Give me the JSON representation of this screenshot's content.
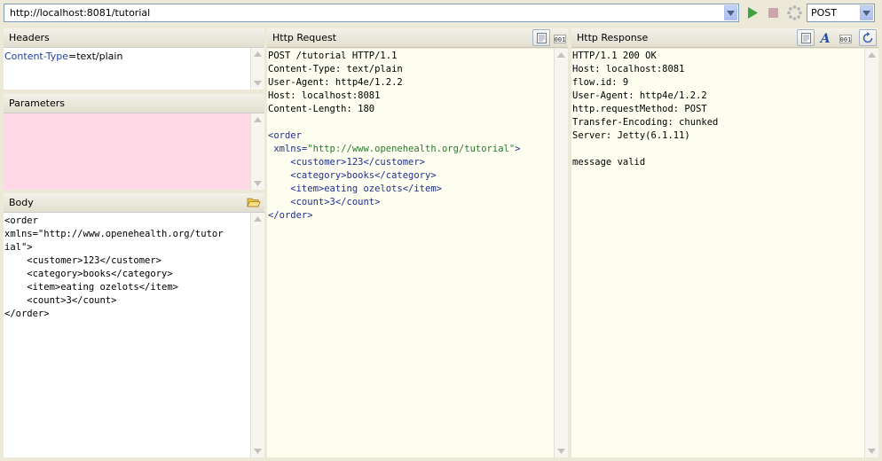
{
  "toolbar": {
    "url": "http://localhost:8081/tutorial",
    "method": "POST",
    "icons": [
      "dropdown-arrow-icon",
      "run-icon",
      "stop-icon",
      "busy-icon",
      "dropdown-arrow-icon"
    ]
  },
  "headers": {
    "title": "Headers",
    "entry_key": "Content-Type",
    "entry_sep": "=",
    "entry_value": "text/plain"
  },
  "parameters": {
    "title": "Parameters"
  },
  "body": {
    "title": "Body",
    "lines": [
      "<order",
      "xmlns=\"http://www.openehealth.org/tutor",
      "ial\">",
      "    <customer>123</customer>",
      "    <category>books</category>",
      "    <item>eating ozelots</item>",
      "    <count>3</count>",
      "</order>"
    ]
  },
  "request": {
    "title": "Http Request",
    "header_lines": [
      "POST /tutorial HTTP/1.1",
      "Content-Type: text/plain",
      "User-Agent: http4e/1.2.2",
      "Host: localhost:8081",
      "Content-Length: 180"
    ],
    "xml": {
      "open_tag": "<order",
      "attr_name": "xmlns=",
      "attr_value": "\"http://www.openehealth.org/tutorial\"",
      "attr_close": ">",
      "children": [
        "    <customer>123</customer>",
        "    <category>books</category>",
        "    <item>eating ozelots</item>",
        "    <count>3</count>"
      ],
      "close_tag": "</order>"
    }
  },
  "response": {
    "title": "Http Response",
    "lines": [
      "HTTP/1.1 200 OK",
      "Host: localhost:8081",
      "flow.id: 9",
      "User-Agent: http4e/1.2.2",
      "http.requestMethod: POST",
      "Transfer-Encoding: chunked",
      "Server: Jetty(6.1.11)",
      "",
      "message valid"
    ]
  },
  "colors": {
    "chrome": "#ece9d8",
    "parameters_bg": "#ffd9e6",
    "request_bg": "#fdfdf0",
    "response_bg": "#fdfdf0",
    "xml_value": "#2a7a2a"
  }
}
